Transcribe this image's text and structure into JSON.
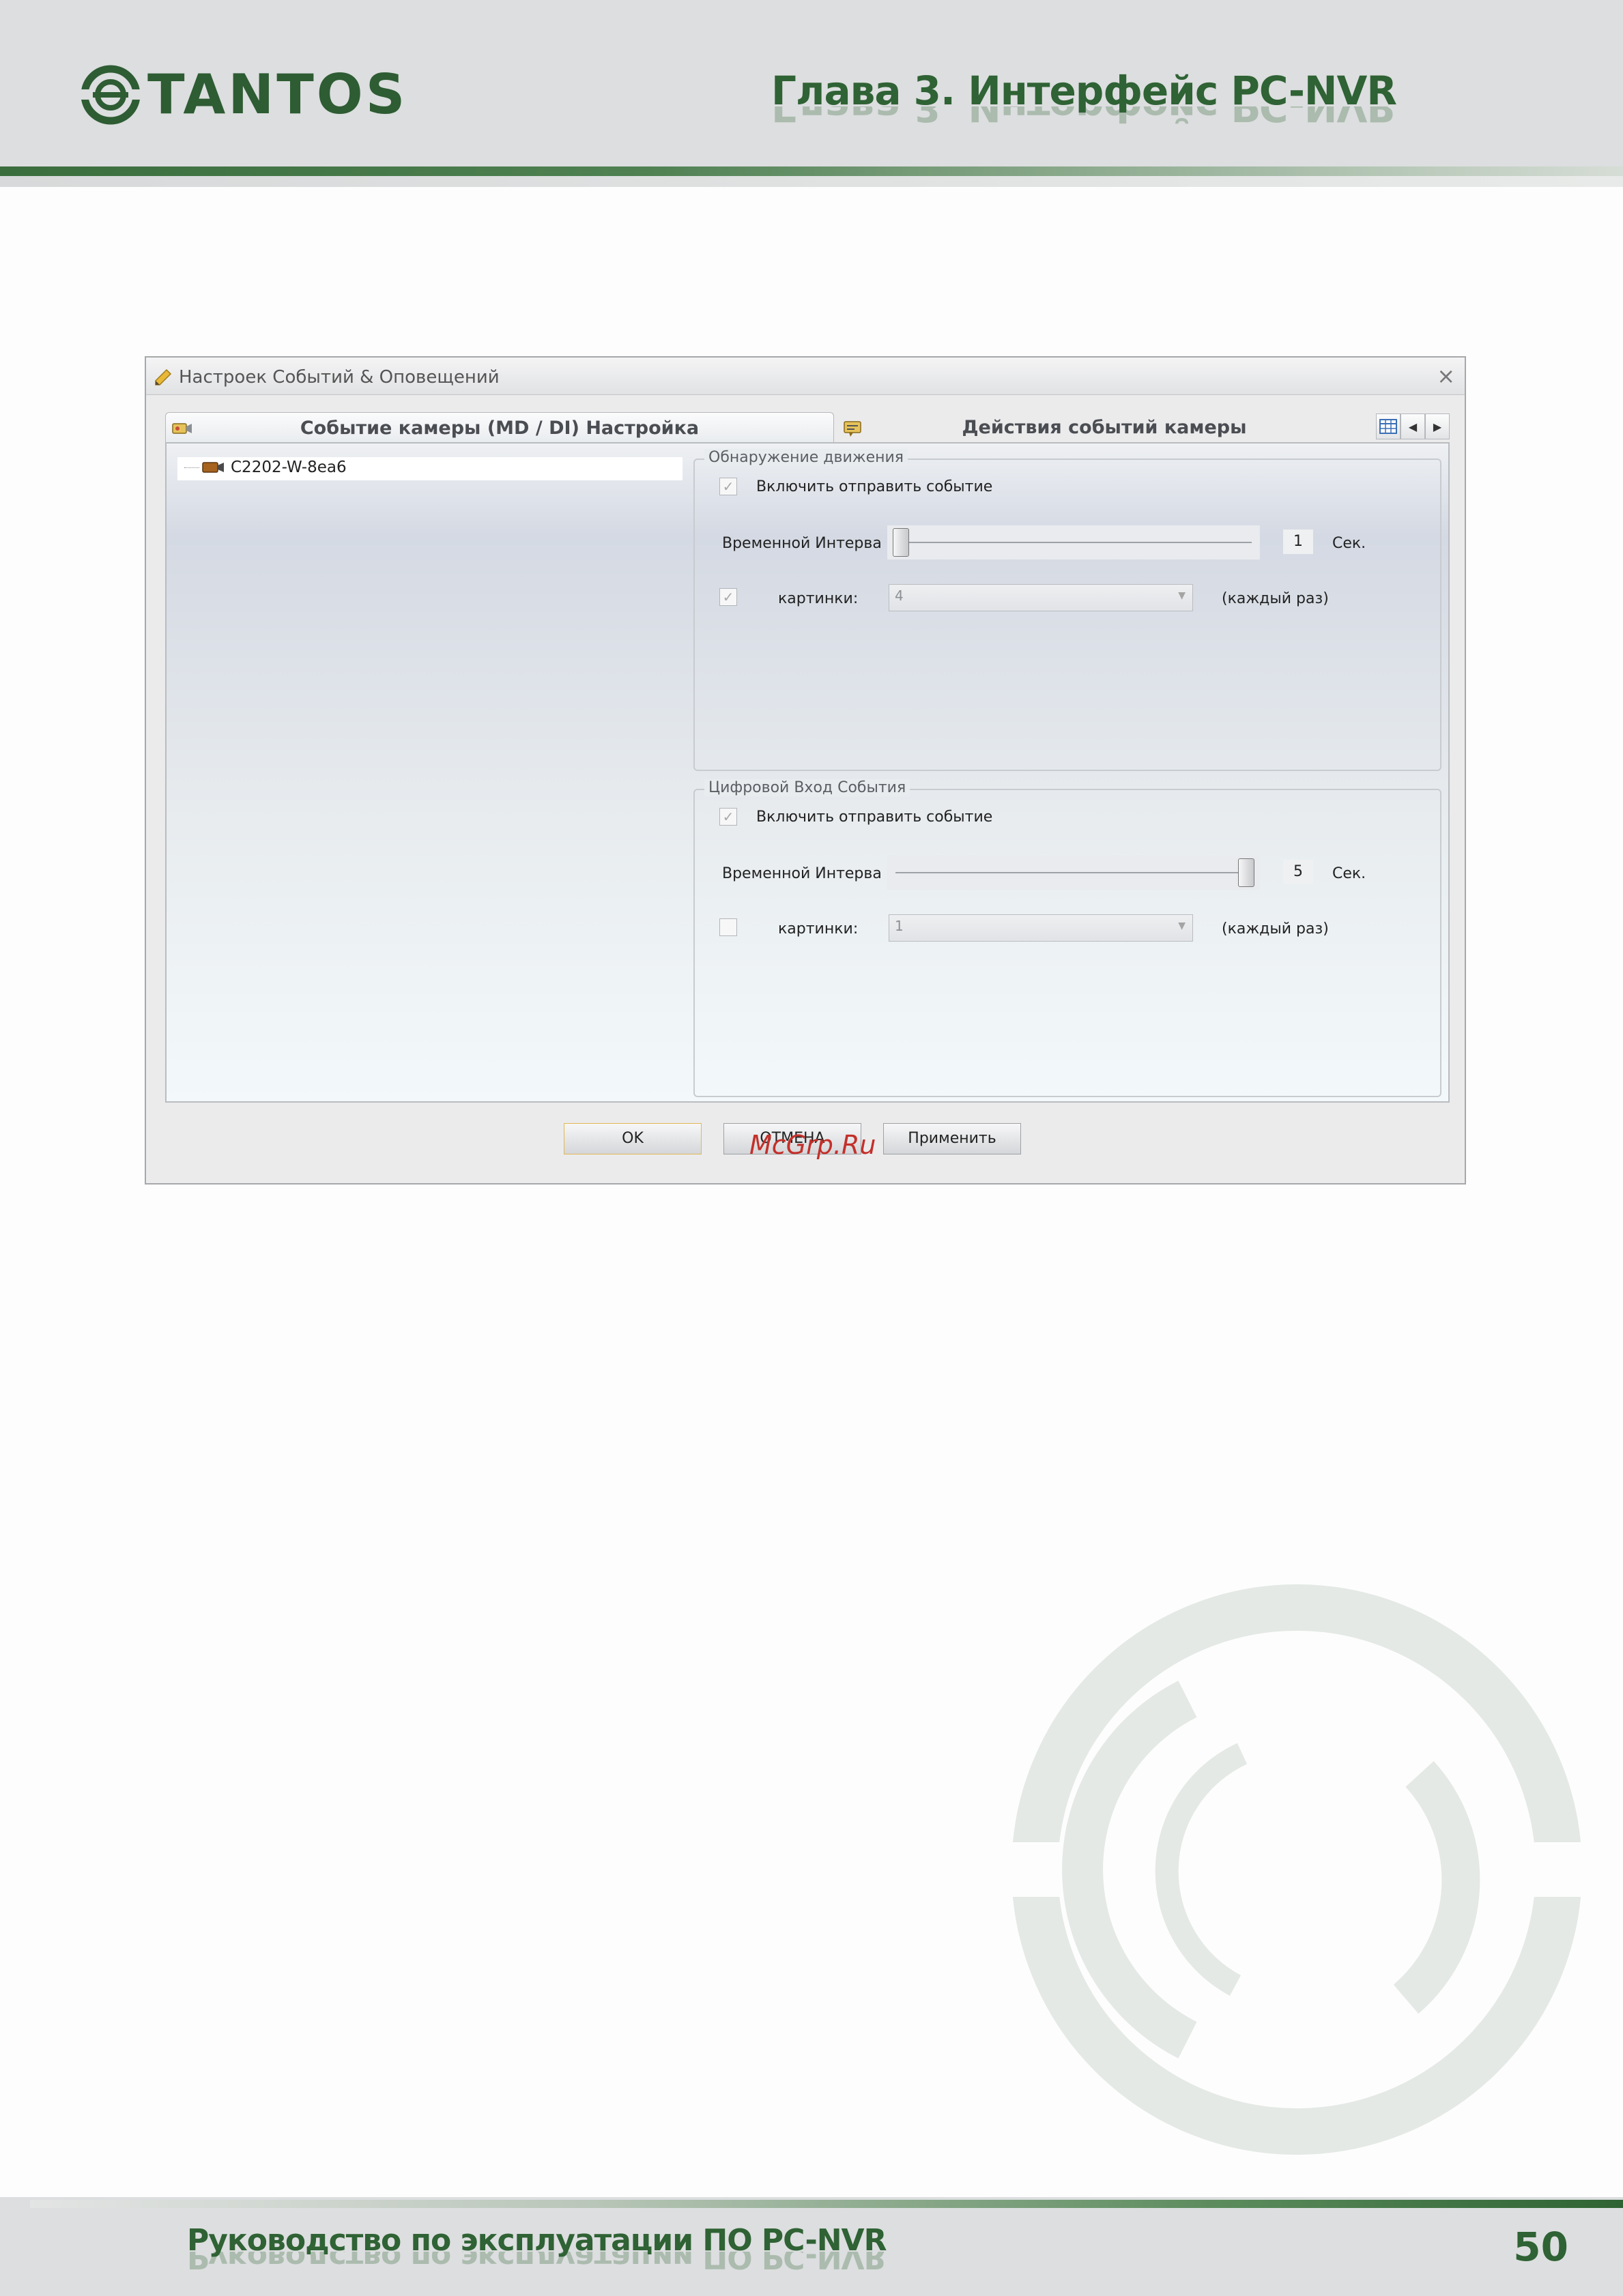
{
  "header": {
    "logo_text": "TANTOS",
    "chapter_title": "Глава 3. Интерфейс PC-NVR"
  },
  "dialog": {
    "title": "Настроек Событий & Оповещений",
    "tabs": [
      {
        "label": "Событие камеры (MD / DI) Настройка"
      },
      {
        "label": "Действия событий камеры"
      }
    ],
    "tree": {
      "camera": "C2202-W-8ea6"
    },
    "motion": {
      "legend": "Обнаружение движения",
      "enable_label": "Включить отправить событие",
      "enable_checked": true,
      "interval_label": "Временной Интерва",
      "interval_value": "1",
      "interval_unit": "Сек.",
      "interval_fraction": 0.0,
      "pictures_label": "картинки:",
      "pictures_checked": true,
      "pictures_value": "4",
      "pictures_suffix": "(каждый раз)"
    },
    "digital": {
      "legend": "Цифровой Вход События",
      "enable_label": "Включить отправить событие",
      "enable_checked": true,
      "interval_label": "Временной Интерва",
      "interval_value": "5",
      "interval_unit": "Сек.",
      "interval_fraction": 1.0,
      "pictures_label": "картинки:",
      "pictures_checked": false,
      "pictures_value": "1",
      "pictures_suffix": "(каждый раз)"
    },
    "buttons": {
      "ok": "OK",
      "cancel": "ОТМЕНА",
      "apply": "Применить"
    }
  },
  "site_watermark": "McGrp.Ru",
  "footer": {
    "title": "Руководство по эксплуатации ПО PC-NVR",
    "page_number": "50"
  },
  "colors": {
    "brand_green": "#2f6234",
    "ok_border": "#e2b955"
  }
}
